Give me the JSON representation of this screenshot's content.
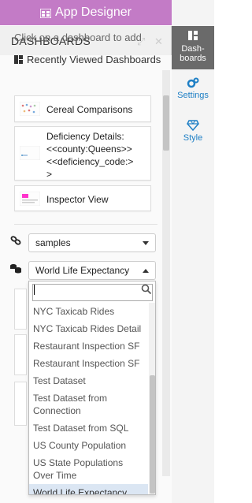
{
  "header": {
    "title": "App Designer",
    "icon": "app-grid-icon",
    "color": "#c37bc6"
  },
  "rail": {
    "tabs": [
      {
        "label": "Dash-\nboards",
        "icon": "dashboards-icon",
        "active": true
      },
      {
        "label": "Settings",
        "icon": "gears-icon"
      },
      {
        "label": "Style",
        "icon": "diamond-icon"
      }
    ]
  },
  "panel": {
    "title": "DASHBOARDS",
    "hint": "Click on a dashboard to add",
    "recent_title": "Recently Viewed Dashboards",
    "recent": [
      {
        "label": "Cereal Comparisons"
      },
      {
        "label": "Deficiency Details:\n<<county:Queens>>\n<<deficiency_code:>\n>"
      },
      {
        "label": "Inspector View"
      }
    ],
    "connection": {
      "value": "samples",
      "icon": "link-icon"
    },
    "dataset": {
      "value": "World Life Expectancy",
      "icon": "datasets-icon"
    }
  },
  "dropdown": {
    "search_value": "",
    "options": [
      "NYC Taxicab Rides",
      "NYC Taxicab Rides Detail",
      "Restaurant Inspection SF",
      "Restaurant Inspection SF",
      "Test Dataset",
      "Test Dataset from Connection",
      "Test Dataset from SQL",
      "US County Population",
      "US State Populations Over Time",
      "World Life Expectancy"
    ],
    "selected_index": 9
  }
}
